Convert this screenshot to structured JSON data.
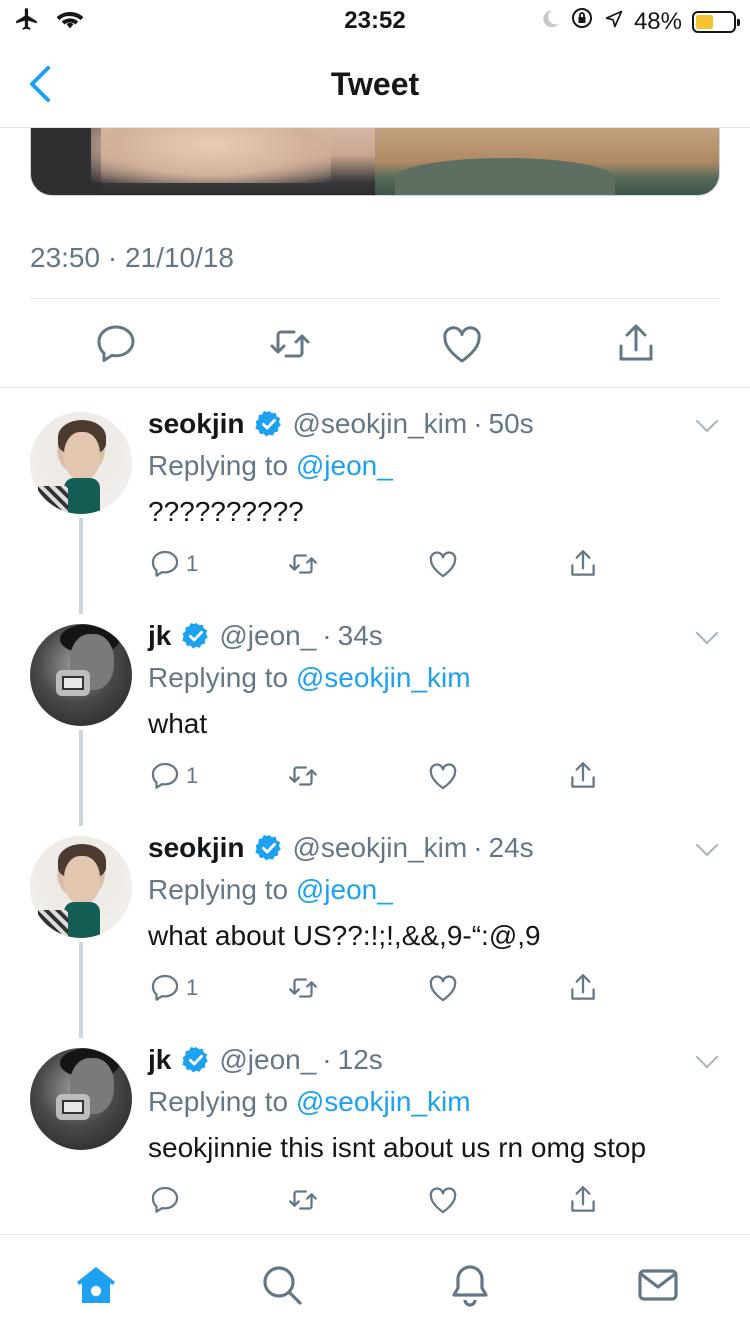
{
  "status_bar": {
    "time": "23:52",
    "battery_percent": "48%",
    "battery_level": 0.48,
    "icons": [
      "airplane-icon",
      "wifi-icon",
      "moon-icon",
      "orientation-lock-icon",
      "location-arrow-icon",
      "battery-icon"
    ]
  },
  "nav": {
    "title": "Tweet",
    "back_icon": "chevron-left-icon"
  },
  "tweet": {
    "timestamp": "23:50 · 21/10/18",
    "actions": [
      "reply-icon",
      "retweet-icon",
      "like-icon",
      "share-icon"
    ]
  },
  "replies": [
    {
      "name": "seokjin",
      "handle": "@seokjin_kim",
      "separator": "·",
      "time": "50s",
      "replying_prefix": "Replying to",
      "replying_to": "@jeon_",
      "text": "??????????",
      "reply_count": "1"
    },
    {
      "name": "jk",
      "handle": "@jeon_",
      "separator": "·",
      "time": "34s",
      "replying_prefix": "Replying to",
      "replying_to": "@seokjin_kim",
      "text": "what",
      "reply_count": "1"
    },
    {
      "name": "seokjin",
      "handle": "@seokjin_kim",
      "separator": "·",
      "time": "24s",
      "replying_prefix": "Replying to",
      "replying_to": "@jeon_",
      "text": "what about US??:!;!,&&,9-“:@,9",
      "reply_count": "1"
    },
    {
      "name": "jk",
      "handle": "@jeon_",
      "separator": "·",
      "time": "12s",
      "replying_prefix": "Replying to",
      "replying_to": "@seokjin_kim",
      "text": "seokjinnie this isnt about us rn omg stop",
      "reply_count": ""
    }
  ],
  "tabbar": {
    "tabs": [
      "home-icon",
      "search-icon",
      "notifications-icon",
      "messages-icon"
    ]
  },
  "colors": {
    "accent": "#1da1f2",
    "text": "#14171a",
    "secondary": "#657786",
    "divider": "#e1e8ed",
    "battery": "#f4c530"
  }
}
